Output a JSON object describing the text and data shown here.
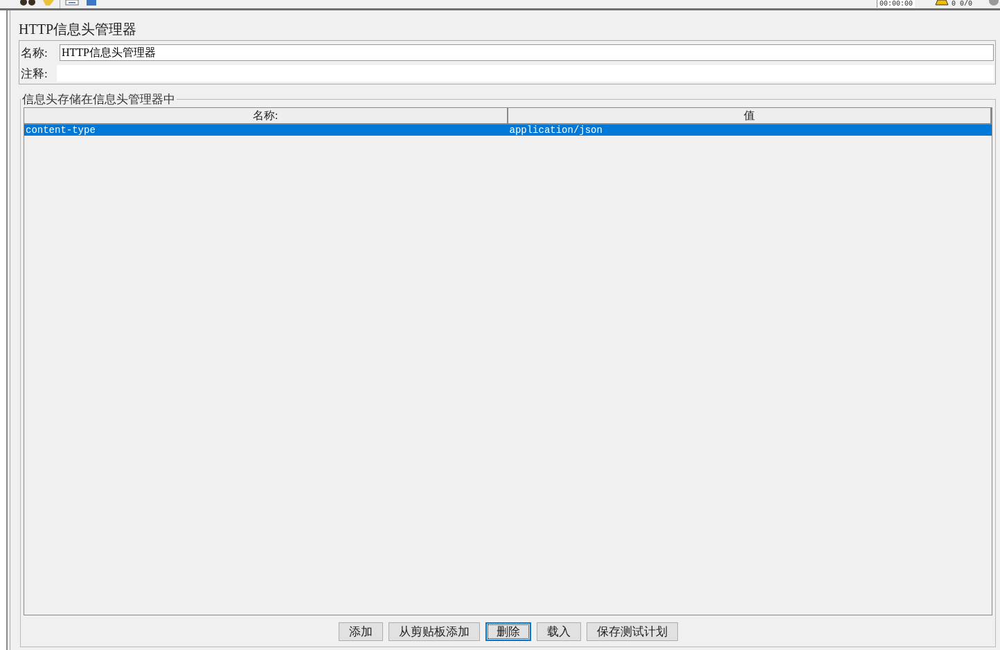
{
  "toolbar": {
    "timer": "00:00:00",
    "counts": "0 0/0"
  },
  "panel": {
    "title": "HTTP信息头管理器",
    "name_label": "名称:",
    "name_value": "HTTP信息头管理器",
    "comment_label": "注释:"
  },
  "headers": {
    "legend": "信息头存储在信息头管理器中",
    "columns": [
      "名称:",
      "值"
    ],
    "rows": [
      {
        "cells": [
          "content-type",
          "application/json"
        ],
        "selected": true
      }
    ]
  },
  "buttons": [
    {
      "label": "添加",
      "focused": false
    },
    {
      "label": "从剪贴板添加",
      "focused": false
    },
    {
      "label": "删除",
      "focused": true
    },
    {
      "label": "载入",
      "focused": false
    },
    {
      "label": "保存测试计划",
      "focused": false
    }
  ]
}
